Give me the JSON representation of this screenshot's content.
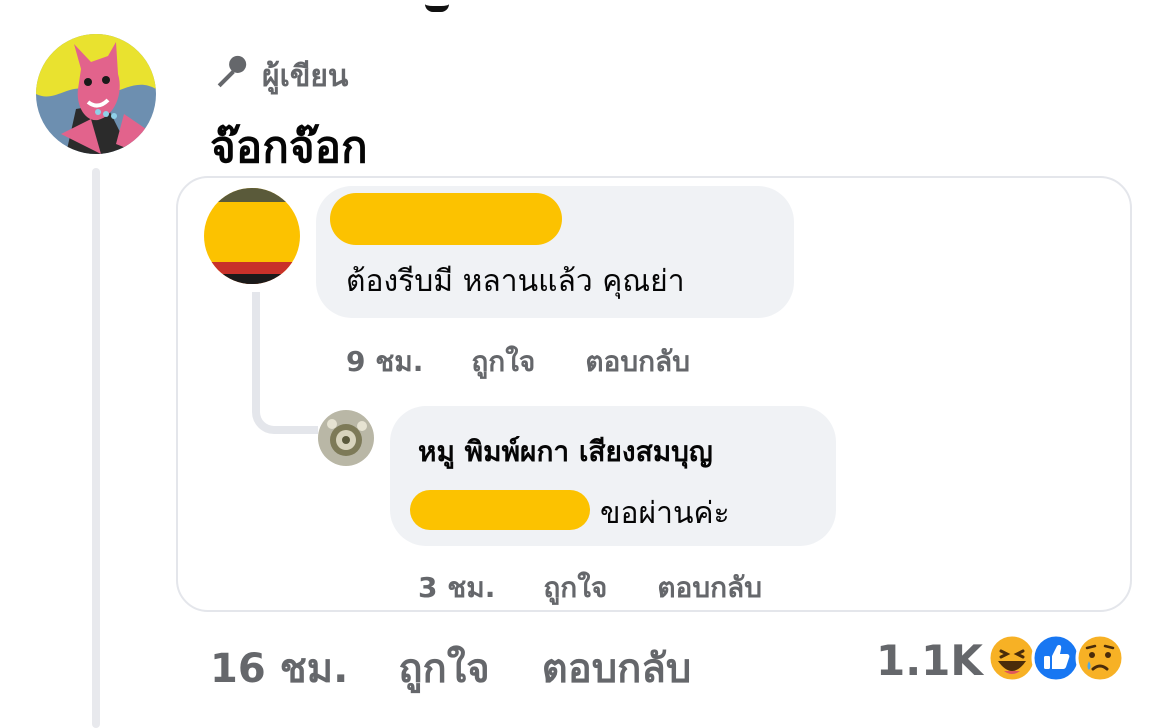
{
  "post_comment": {
    "author_badge": "ผู้เขียน",
    "author_name": "จ๊อกจ๊อก",
    "time": "16 ชม.",
    "like_label": "ถูกใจ",
    "reply_label": "ตอบกลับ",
    "reaction_count": "1.1K",
    "reaction_icons": [
      "haha-icon",
      "like-icon",
      "sad-icon"
    ]
  },
  "shared_screenshot": {
    "comment": {
      "author_name": "",
      "text": "ต้องรีบมี หลานแล้ว คุณย่า",
      "time": "9 ชม.",
      "like_label": "ถูกใจ",
      "reply_label": "ตอบกลับ"
    },
    "reply": {
      "author_name": "หมู พิมพ์ผกา เสียงสมบุญ",
      "text": "ขอผ่านค่ะ",
      "time": "3 ชม.",
      "like_label": "ถูกใจ",
      "reply_label": "ตอบกลับ"
    }
  },
  "colors": {
    "redaction": "#fcc200",
    "muted_text": "#65676b",
    "bubble_bg": "#f0f2f5",
    "like_blue": "#1877f2",
    "emoji_yellow": "#f7b125"
  }
}
